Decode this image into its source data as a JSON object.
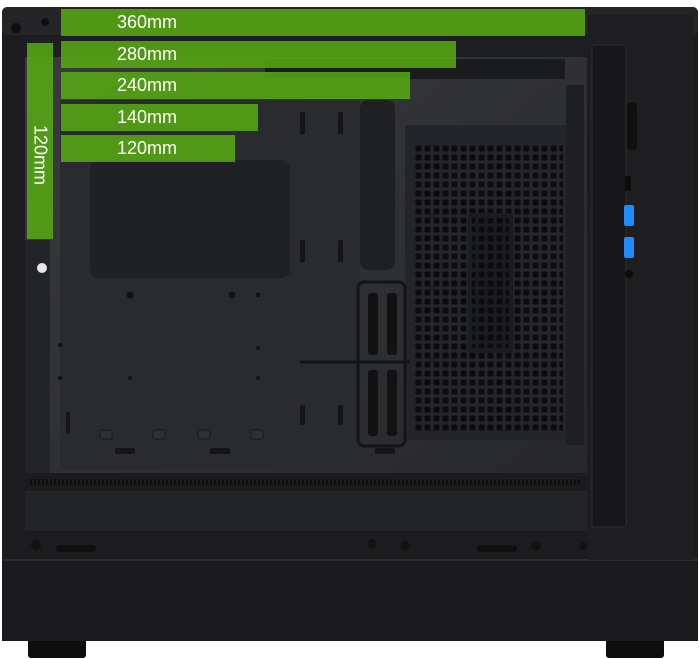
{
  "radiator_support": {
    "top_bars": [
      {
        "label": "360mm"
      },
      {
        "label": "280mm"
      },
      {
        "label": "240mm"
      },
      {
        "label": "140mm"
      },
      {
        "label": "120mm"
      }
    ],
    "front_bar": {
      "label": "120mm"
    }
  },
  "colors": {
    "accent": "#56aa12",
    "case_body": "#1c1c1e",
    "interior": "#2c2d30",
    "usb_port": "#1f8bff"
  },
  "icons": {
    "usb_port": "usb-port-icon",
    "audio_jack": "audio-jack-icon",
    "power_button": "power-button-icon"
  }
}
